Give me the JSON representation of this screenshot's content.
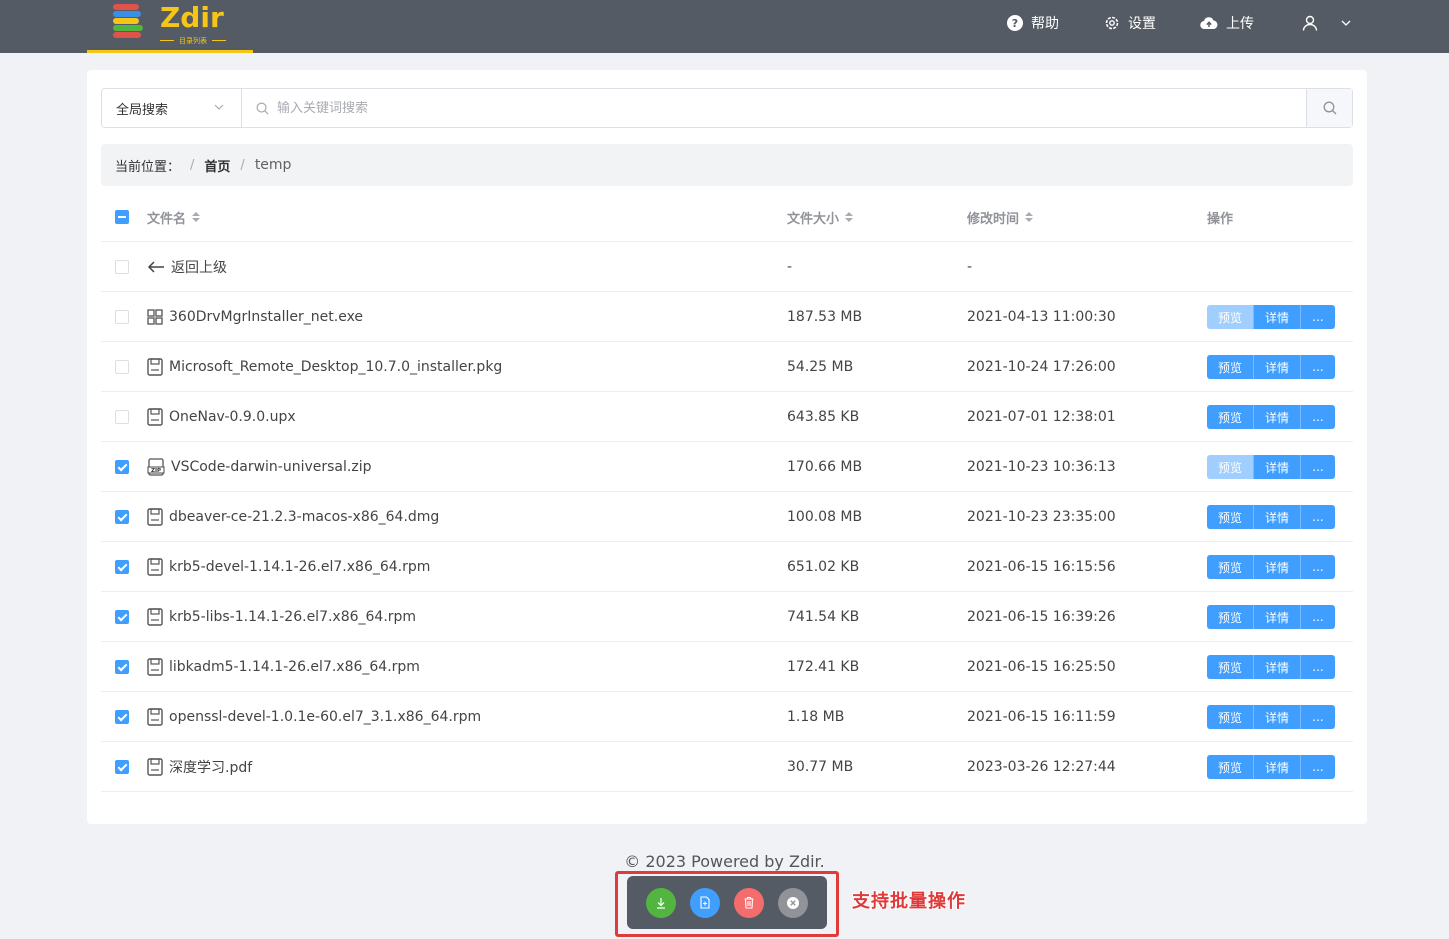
{
  "header": {
    "logo_text": "Zdir",
    "logo_subtitle": "目录列表",
    "help_label": "帮助",
    "settings_label": "设置",
    "upload_label": "上传"
  },
  "search": {
    "scope": "全局搜索",
    "placeholder": "输入关键词搜索"
  },
  "breadcrumb": {
    "prefix": "当前位置：",
    "home": "首页",
    "current": "temp"
  },
  "table": {
    "columns": {
      "name": "文件名",
      "size": "文件大小",
      "time": "修改时间",
      "ops": "操作"
    },
    "parent_row": {
      "label": "返回上级",
      "size": "-",
      "time": "-"
    },
    "action_labels": {
      "preview": "预览",
      "detail": "详情",
      "more": "..."
    },
    "rows": [
      {
        "name": "360DrvMgrInstaller_net.exe",
        "size": "187.53 MB",
        "time": "2021-04-13 11:00:30",
        "checked": false,
        "icon": "windows-icon",
        "preview_enabled": false
      },
      {
        "name": "Microsoft_Remote_Desktop_10.7.0_installer.pkg",
        "size": "54.25 MB",
        "time": "2021-10-24 17:26:00",
        "checked": false,
        "icon": "file-icon",
        "preview_enabled": true
      },
      {
        "name": "OneNav-0.9.0.upx",
        "size": "643.85 KB",
        "time": "2021-07-01 12:38:01",
        "checked": false,
        "icon": "file-icon",
        "preview_enabled": true
      },
      {
        "name": "VSCode-darwin-universal.zip",
        "size": "170.66 MB",
        "time": "2021-10-23 10:36:13",
        "checked": true,
        "icon": "zip-icon",
        "preview_enabled": false
      },
      {
        "name": "dbeaver-ce-21.2.3-macos-x86_64.dmg",
        "size": "100.08 MB",
        "time": "2021-10-23 23:35:00",
        "checked": true,
        "icon": "file-icon",
        "preview_enabled": true
      },
      {
        "name": "krb5-devel-1.14.1-26.el7.x86_64.rpm",
        "size": "651.02 KB",
        "time": "2021-06-15 16:15:56",
        "checked": true,
        "icon": "file-icon",
        "preview_enabled": true
      },
      {
        "name": "krb5-libs-1.14.1-26.el7.x86_64.rpm",
        "size": "741.54 KB",
        "time": "2021-06-15 16:39:26",
        "checked": true,
        "icon": "file-icon",
        "preview_enabled": true
      },
      {
        "name": "libkadm5-1.14.1-26.el7.x86_64.rpm",
        "size": "172.41 KB",
        "time": "2021-06-15 16:25:50",
        "checked": true,
        "icon": "file-icon",
        "preview_enabled": true
      },
      {
        "name": "openssl-devel-1.0.1e-60.el7_3.1.x86_64.rpm",
        "size": "1.18 MB",
        "time": "2021-06-15 16:11:59",
        "checked": true,
        "icon": "file-icon",
        "preview_enabled": true
      },
      {
        "name": "深度学习.pdf",
        "size": "30.77 MB",
        "time": "2023-03-26 12:27:44",
        "checked": true,
        "icon": "file-icon",
        "preview_enabled": true
      }
    ]
  },
  "footer": {
    "text": "© 2023 Powered by Zdir."
  },
  "batch_bar": {
    "buttons": [
      {
        "name": "download-icon",
        "color": "#52b540"
      },
      {
        "name": "copy-link-icon",
        "color": "#409eff"
      },
      {
        "name": "delete-icon",
        "color": "#f56c6c"
      },
      {
        "name": "close-icon",
        "color": "#909399"
      }
    ],
    "annotation": "支持批量操作"
  },
  "colors": {
    "topbar": "#545b64",
    "accent": "#409eff",
    "brand": "#f5c518",
    "annotation": "#e03a3a"
  }
}
